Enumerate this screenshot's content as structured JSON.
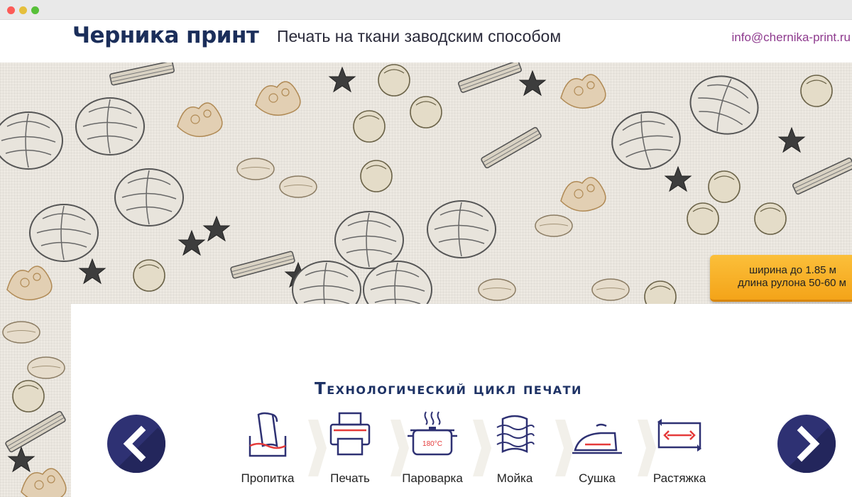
{
  "site": {
    "logo_text": "Черника принт",
    "tagline": "Печать на ткани заводским способом",
    "email": "info@chernika-print.ru"
  },
  "badge": {
    "line1": "ширина до 1.85 м",
    "line2": "длина рулона 50-60 м"
  },
  "process": {
    "title": "Технологический цикл печати",
    "steps": [
      {
        "label": "Пропитка",
        "icon": "fabric-soaking-icon"
      },
      {
        "label": "Печать",
        "icon": "printer-icon"
      },
      {
        "label": "Пароварка",
        "icon": "steamer-pot-icon",
        "icon_text": "180°C"
      },
      {
        "label": "Мойка",
        "icon": "washing-icon"
      },
      {
        "label": "Сушка",
        "icon": "iron-icon"
      },
      {
        "label": "Растяжка",
        "icon": "stretch-icon"
      }
    ]
  },
  "colors": {
    "brand_navy": "#1b2e5a",
    "arrow_bg": "#2e3173",
    "email_purple": "#8e3a8e",
    "badge_orange": "#f4a419",
    "icon_red": "#e53a3a"
  }
}
